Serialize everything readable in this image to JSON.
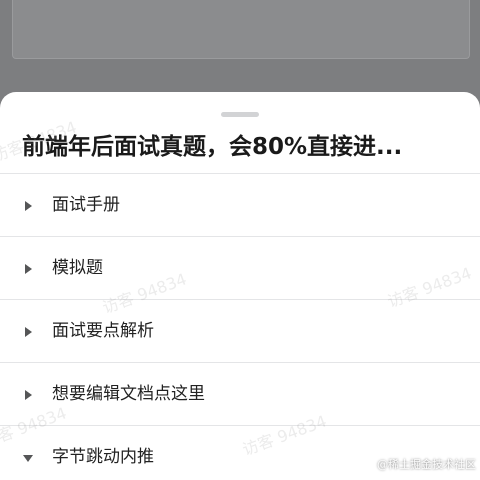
{
  "sheet": {
    "title": "前端年后面试真题，会80%直接进..."
  },
  "menu": {
    "items": [
      {
        "label": "面试手册",
        "expanded": false
      },
      {
        "label": "模拟题",
        "expanded": false
      },
      {
        "label": "面试要点解析",
        "expanded": false
      },
      {
        "label": "想要编辑文档点这里",
        "expanded": false
      },
      {
        "label": "字节跳动内推",
        "expanded": true
      }
    ]
  },
  "watermark": {
    "text": "访客 94834"
  },
  "source_mark": {
    "text": "@稀土掘金技术社区"
  }
}
